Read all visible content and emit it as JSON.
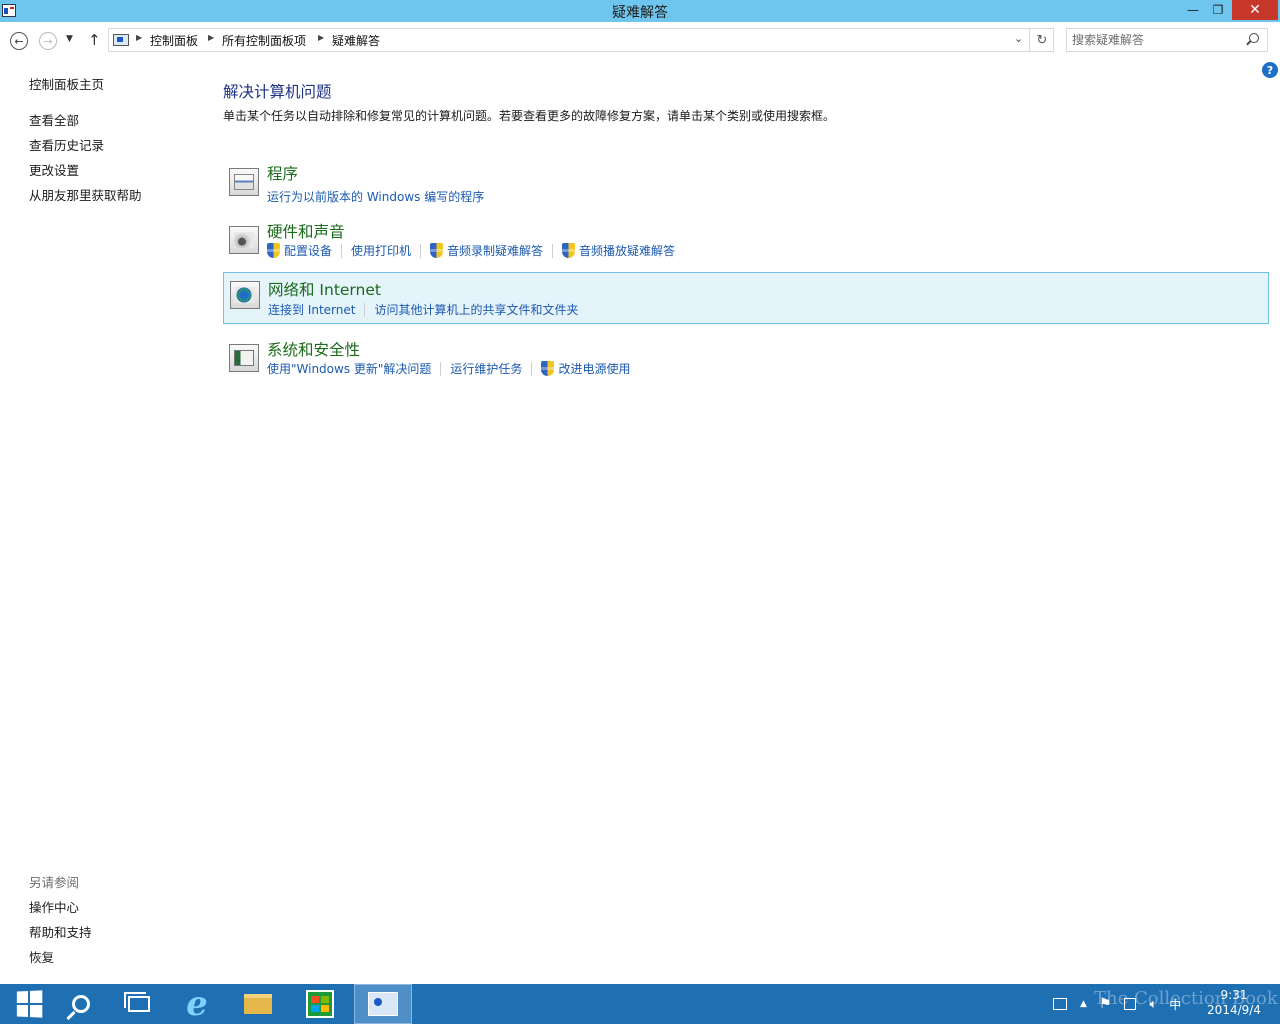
{
  "window": {
    "title": "疑难解答"
  },
  "window_controls": {
    "minimize": "—",
    "maximize": "❐",
    "close": "✕"
  },
  "address": {
    "breadcrumbs": [
      "控制面板",
      "所有控制面板项",
      "疑难解答"
    ],
    "search_placeholder": "搜索疑难解答"
  },
  "left_nav": {
    "home": "控制面板主页",
    "links": [
      "查看全部",
      "查看历史记录",
      "更改设置",
      "从朋友那里获取帮助"
    ],
    "see_also_title": "另请参阅",
    "see_also": [
      "操作中心",
      "帮助和支持",
      "恢复"
    ]
  },
  "main": {
    "title": "解决计算机问题",
    "description": "单击某个任务以自动排除和修复常见的计算机问题。若要查看更多的故障修复方案，请单击某个类别或使用搜索框。",
    "categories": [
      {
        "title": "程序",
        "links": [
          "运行为以前版本的 Windows 编写的程序"
        ]
      },
      {
        "title": "硬件和声音",
        "links": [
          "配置设备",
          "使用打印机",
          "音频录制疑难解答",
          "音频播放疑难解答"
        ]
      },
      {
        "title": "网络和 Internet",
        "links": [
          "连接到 Internet",
          "访问其他计算机上的共享文件和文件夹"
        ]
      },
      {
        "title": "系统和安全性",
        "links": [
          "使用\"Windows 更新\"解决问题",
          "运行维护任务",
          "改进电源使用"
        ]
      }
    ]
  },
  "taskbar": {
    "items": [
      "start-icon",
      "search-icon",
      "task-view-icon",
      "internet-explorer-icon",
      "file-explorer-icon",
      "store-icon",
      "control-panel-icon"
    ],
    "ie_glyph": "e",
    "ime": "中",
    "time": "9:31",
    "date": "2014/9/4",
    "tray_arrow": "▲",
    "watermark": "The Collection Book"
  },
  "colors": {
    "titlebar": "#6ec6ee",
    "taskbar": "#1f6fb3",
    "link": "#1b5ab0",
    "category_title": "#1a6b1a",
    "heading": "#1e3287"
  }
}
